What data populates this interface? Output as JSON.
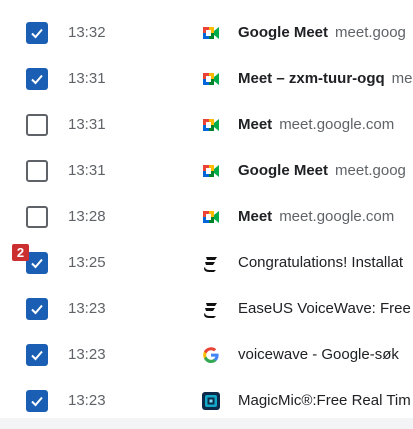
{
  "history": {
    "rows": [
      {
        "checked": true,
        "time": "13:32",
        "title": "Google Meet",
        "domain": "meet.goog",
        "icon": "google-meet-icon"
      },
      {
        "checked": true,
        "time": "13:31",
        "title": "Meet – zxm-tuur-ogq",
        "domain": "me",
        "icon": "google-meet-icon"
      },
      {
        "checked": false,
        "time": "13:31",
        "title": "Meet",
        "domain": "meet.google.com",
        "icon": "google-meet-icon"
      },
      {
        "checked": false,
        "time": "13:31",
        "title": "Google Meet",
        "domain": "meet.goog",
        "icon": "google-meet-icon"
      },
      {
        "checked": false,
        "time": "13:28",
        "title": "Meet",
        "domain": "meet.google.com",
        "icon": "google-meet-icon"
      },
      {
        "checked": true,
        "time": "13:25",
        "title": "Congratulations! Installat",
        "domain": "",
        "icon": "easeus-icon"
      },
      {
        "checked": true,
        "time": "13:23",
        "title": "EaseUS VoiceWave: Free F",
        "domain": "",
        "icon": "easeus-icon"
      },
      {
        "checked": true,
        "time": "13:23",
        "title": "voicewave - Google-søk",
        "domain": "",
        "icon": "google-g-icon"
      },
      {
        "checked": true,
        "time": "13:23",
        "title": "MagicMic®:Free Real Tim",
        "domain": "",
        "icon": "magicmic-icon"
      }
    ]
  },
  "annotation": {
    "badge_label": "2"
  },
  "colors": {
    "checkbox_checked": "#1a5fb4",
    "checkbox_unchecked_border": "#5f6368",
    "title_text": "#202124",
    "secondary_text": "#5f6368",
    "badge": "#cc2f2f"
  }
}
